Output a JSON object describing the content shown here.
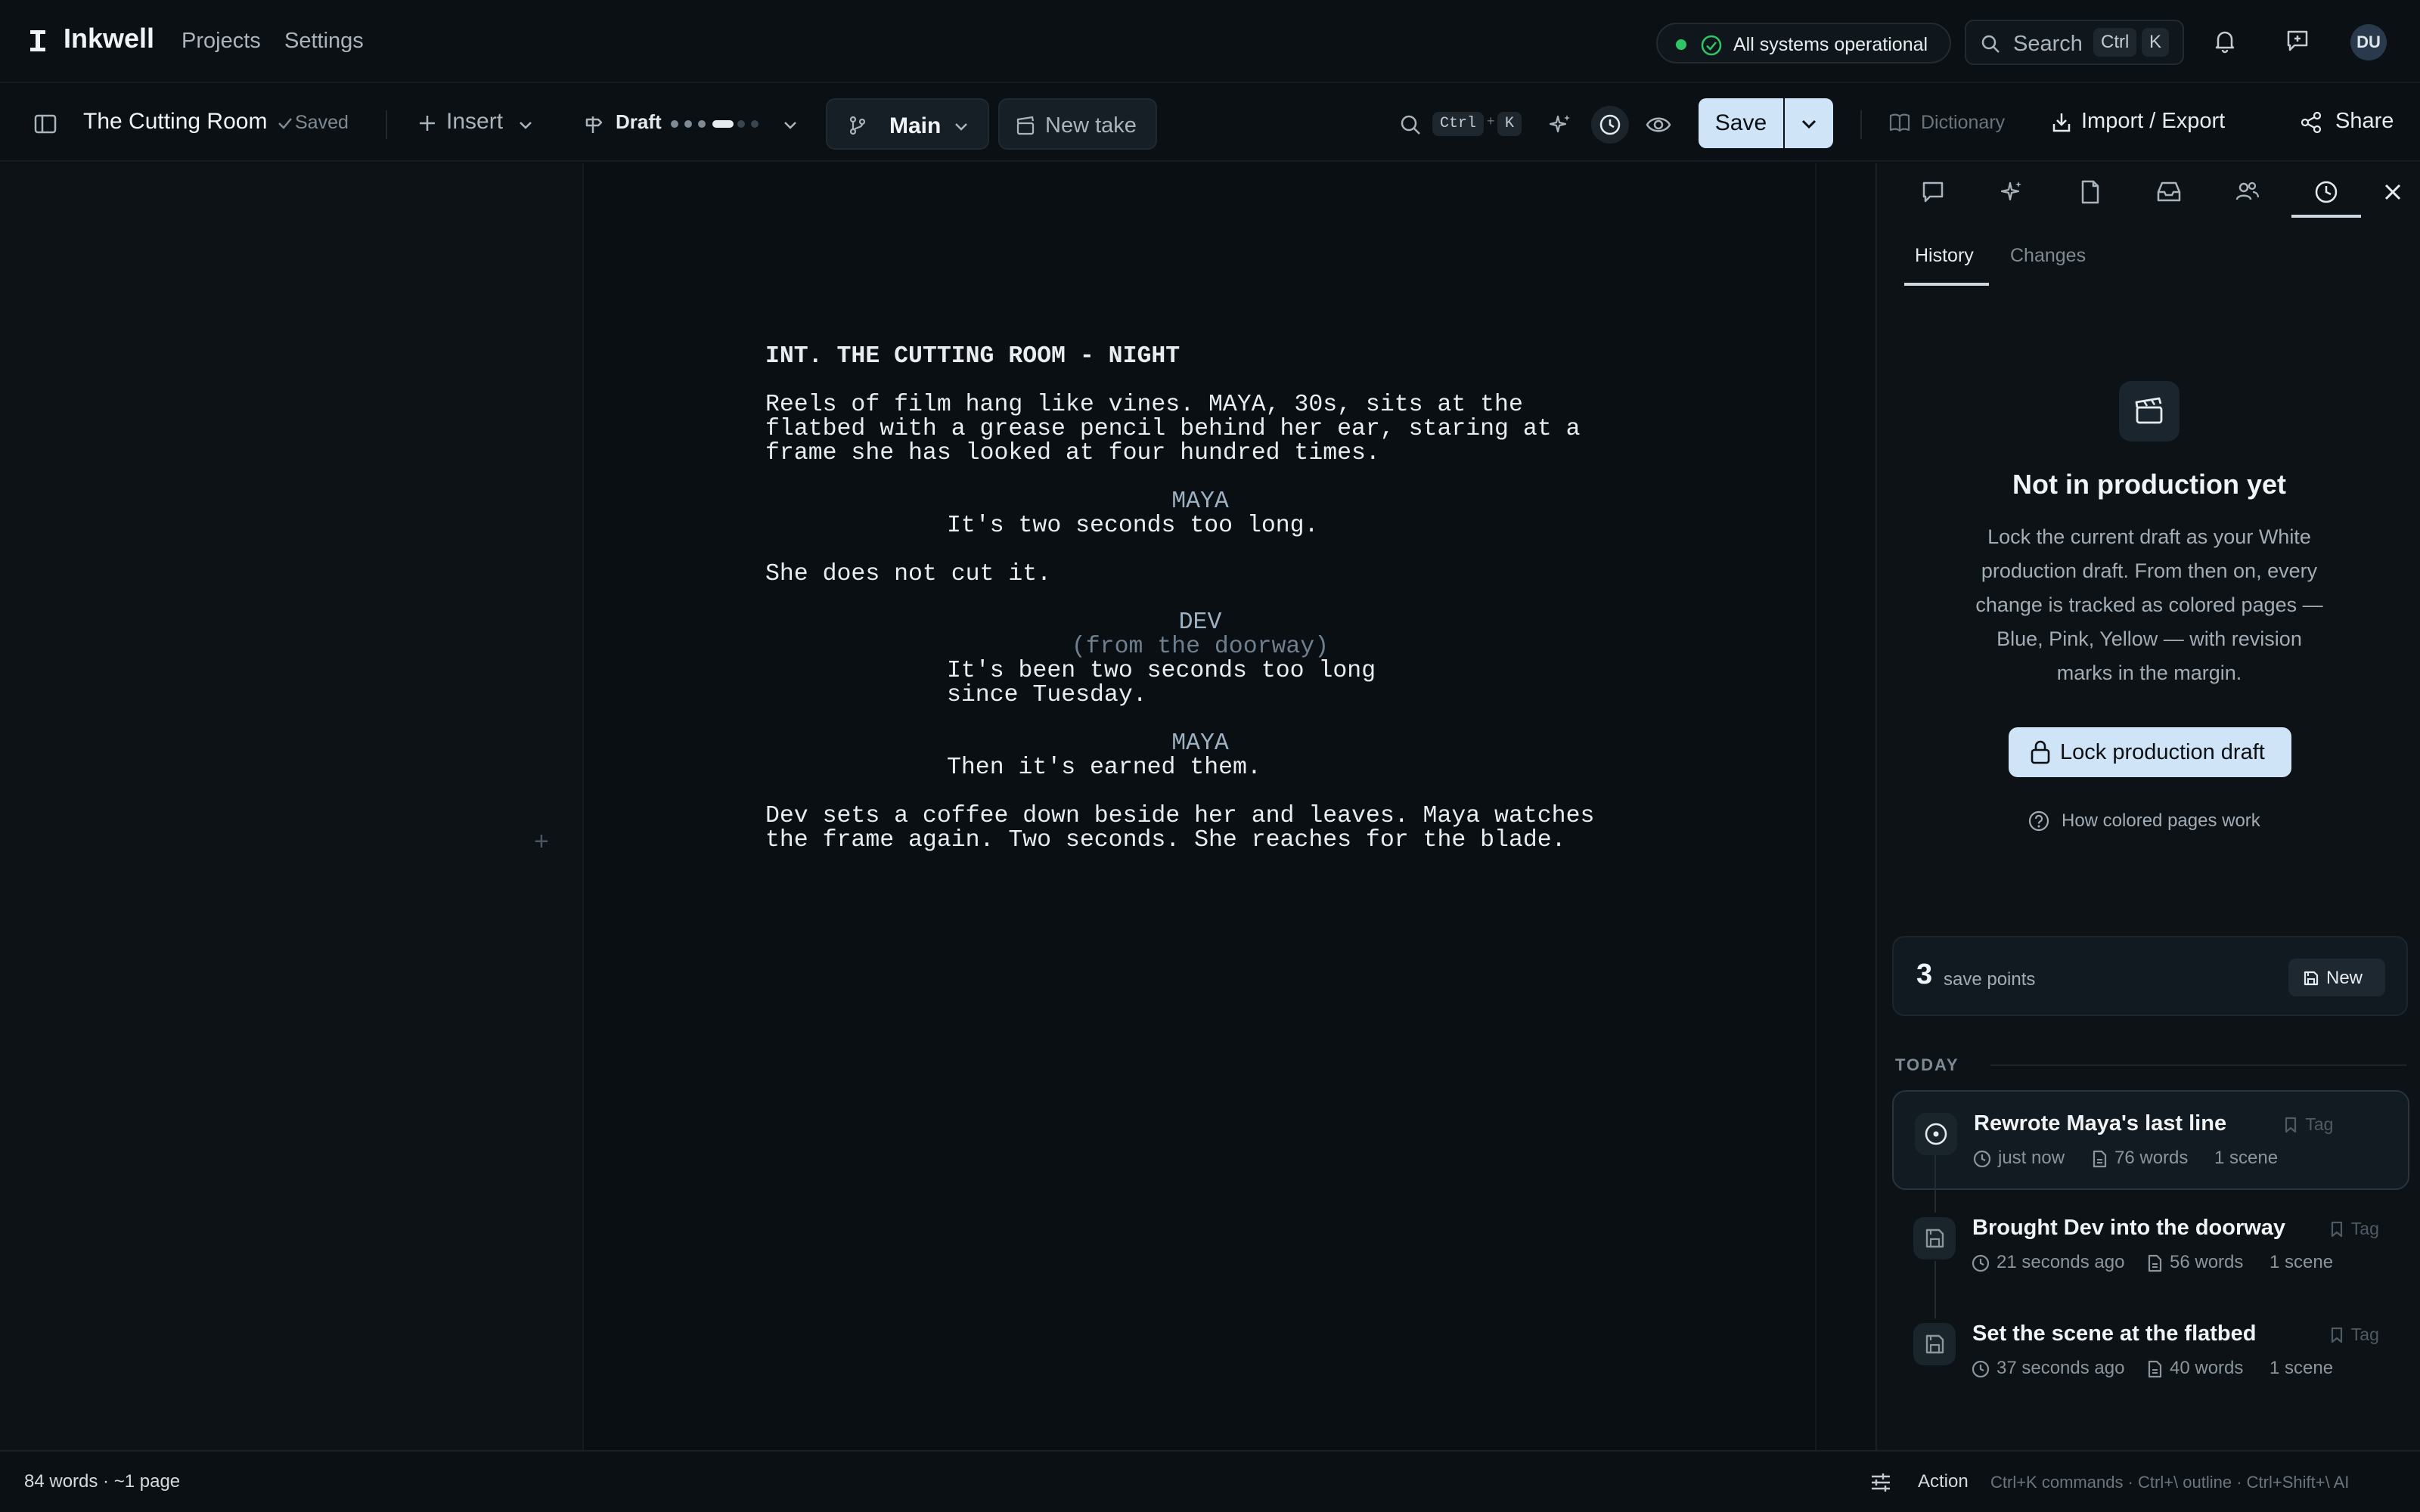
{
  "app": {
    "name": "Inkwell",
    "nav": [
      "Projects",
      "Settings"
    ],
    "status": "All systems operational",
    "search_label": "Search",
    "search_kbd": [
      "Ctrl",
      "K"
    ],
    "avatar_initials": "DU"
  },
  "toolbar": {
    "doc_title": "The Cutting Room",
    "saved_label": "Saved",
    "insert_label": "Insert",
    "draft_label": "Draft",
    "draft_progress": {
      "current": 4,
      "total": 6
    },
    "branch_label": "Main",
    "new_take_label": "New take",
    "find_kbd": [
      "Ctrl",
      "K"
    ],
    "save_label": "Save",
    "dictionary_label": "Dictionary",
    "import_export_label": "Import / Export",
    "share_label": "Share"
  },
  "script": {
    "lines": [
      {
        "type": "heading",
        "text": "INT. THE CUTTING ROOM - NIGHT",
        "row": 0
      },
      {
        "type": "action",
        "text": "Reels of film hang like vines. MAYA, 30s, sits at the",
        "row": 2
      },
      {
        "type": "action",
        "text": "flatbed with a grease pencil behind her ear, staring at a",
        "row": 3
      },
      {
        "type": "action",
        "text": "frame she has looked at four hundred times.",
        "row": 4
      },
      {
        "type": "character",
        "text": "MAYA",
        "row": 6
      },
      {
        "type": "dialogue",
        "text": "It's two seconds too long.",
        "row": 7
      },
      {
        "type": "action",
        "text": "She does not cut it.",
        "row": 9
      },
      {
        "type": "character",
        "text": "DEV",
        "row": 11
      },
      {
        "type": "parenthetical",
        "text": "(from the doorway)",
        "row": 12
      },
      {
        "type": "dialogue",
        "text": "It's been two seconds too long",
        "row": 13
      },
      {
        "type": "dialogue",
        "text": "since Tuesday.",
        "row": 14
      },
      {
        "type": "character",
        "text": "MAYA",
        "row": 16
      },
      {
        "type": "dialogue",
        "text": "Then it's earned them.",
        "row": 17
      },
      {
        "type": "action",
        "text": "Dev sets a coffee down beside her and leaves. Maya watches",
        "row": 19
      },
      {
        "type": "action",
        "text": "the frame again. Two seconds. She reaches for the blade.",
        "row": 20
      }
    ]
  },
  "panel": {
    "subtabs": [
      "History",
      "Changes"
    ],
    "empty_title": "Not in production yet",
    "empty_desc": "Lock the current draft as your White production draft. From then on, every change is tracked as colored pages — Blue, Pink, Yellow — with revision marks in the margin.",
    "lock_label": "Lock production draft",
    "how_label": "How colored pages work",
    "save_points_count": "3",
    "save_points_label": "save points",
    "new_label": "New",
    "section_label": "TODAY",
    "tag_label": "Tag",
    "history": [
      {
        "title": "Rewrote Maya's last line",
        "time": "just now",
        "words": "76 words",
        "scenes": "1 scene",
        "active": true
      },
      {
        "title": "Brought Dev into the doorway",
        "time": "21 seconds ago",
        "words": "56 words",
        "scenes": "1 scene",
        "active": false
      },
      {
        "title": "Set the scene at the flatbed",
        "time": "37 seconds ago",
        "words": "40 words",
        "scenes": "1 scene",
        "active": false
      }
    ]
  },
  "statusbar": {
    "word_count": "84 words · ~1 page",
    "mode": "Action",
    "hint": "Ctrl+K commands · Ctrl+\\ outline · Ctrl+Shift+\\ AI"
  },
  "colors": {
    "background": "#0b1014",
    "accent_button": "#cfe4f6",
    "status_ok": "#2fc766"
  }
}
